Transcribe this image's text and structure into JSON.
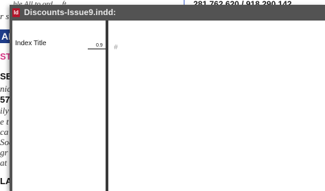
{
  "window": {
    "title": "Discounts-Issue9.indd:",
    "app_icon_label": "Id"
  },
  "left_panel": {
    "index_title": "Index Title",
    "page_number": "0.9"
  },
  "right_panel": {
    "marker": "#"
  },
  "background_document": {
    "top_left_text": "ihle All to ord ... ft",
    "top_right_text": "281.762.620 / 918.290.142",
    "left_fragments": [
      {
        "text": "r s",
        "style": "italic"
      },
      {
        "text": "AL",
        "style": "blue-bar"
      },
      {
        "text": "ST",
        "style": "pink"
      },
      {
        "text": "SE",
        "style": "bold"
      },
      {
        "text": "nic",
        "style": "italic"
      },
      {
        "text": "57",
        "style": "bold"
      },
      {
        "text": "ily",
        "style": "italic"
      },
      {
        "text": "e t",
        "style": "italic"
      },
      {
        "text": "ca",
        "style": "italic"
      },
      {
        "text": "Soc",
        "style": "italic"
      },
      {
        "text": "gr",
        "style": "italic"
      },
      {
        "text": "at",
        "style": "italic"
      },
      {
        "text": "LA",
        "style": "bold"
      }
    ]
  },
  "colors": {
    "window_chrome": "#535353",
    "title_text": "#e9e9e9",
    "app_icon": "#b3162b",
    "doc_accent_blue": "#1f3d8a",
    "doc_accent_pink": "#d63384"
  }
}
